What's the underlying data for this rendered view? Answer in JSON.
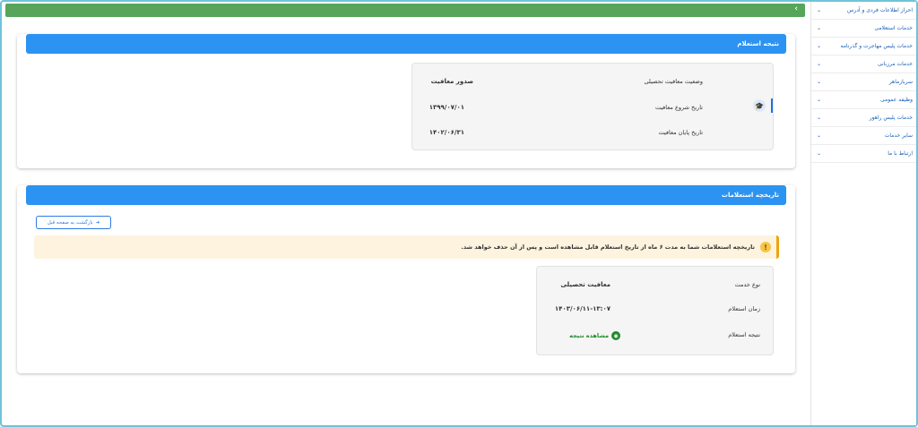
{
  "sidebar": {
    "items": [
      {
        "label": "احراز اطلاعات فردی و آدرس"
      },
      {
        "label": "خدمات استعلامی"
      },
      {
        "label": "خدمات پلیس مهاجرت و گذرنامه"
      },
      {
        "label": "خدمات مرزبانی"
      },
      {
        "label": "سربازماهر"
      },
      {
        "label": "وظیفه عمومی"
      },
      {
        "label": "خدمات پلیس راهور"
      },
      {
        "label": "سایر خدمات"
      },
      {
        "label": "ارتباط با ما"
      }
    ],
    "chevron": "⌄"
  },
  "topbar": {
    "collapse_icon": "‹",
    "color": "#56a55a"
  },
  "result": {
    "title": "نتیجه استعلام",
    "rows": [
      {
        "label": "وضعیت معافیت تحصیلی",
        "value": "صدور معافیت"
      },
      {
        "label": "تاریخ شروع معافیت",
        "value": "۱۳۹۹/۰۷/۰۱"
      },
      {
        "label": "تاریخ پایان معافیت",
        "value": "۱۴۰۲/۰۶/۳۱"
      }
    ],
    "icon": "graduation-cap-icon"
  },
  "history": {
    "title": "تاریخچه استعلامات",
    "back_label": "بازگشت به صفحه قبل",
    "warning": "تاریخچه استعلامات شما به مدت ۶ ماه از تاریخ استعلام قابل مشاهده است و پس از آن حذف خواهد شد.",
    "rows": [
      {
        "label": "نوع خدمت",
        "value": "معافیت تحصیلی"
      },
      {
        "label": "زمان استعلام",
        "value": "۱۴۰۳/۰۶/۱۱-۱۳:۰۷"
      },
      {
        "label": "نتیجه استعلام",
        "value": "مشاهده نتیجه"
      }
    ]
  },
  "colors": {
    "header_blue": "#2c93f2",
    "link_green": "#1f8a2a",
    "warn_bg": "#fdf3df"
  }
}
